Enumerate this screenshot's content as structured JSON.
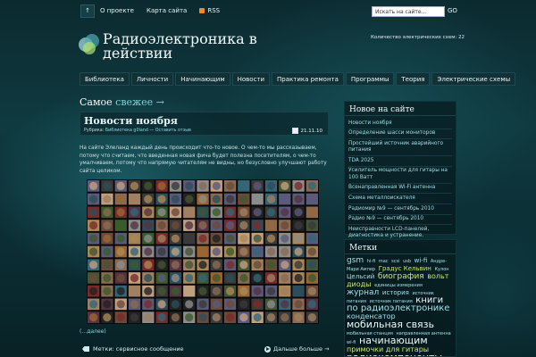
{
  "topbar": {
    "home_label": "↑",
    "nav": [
      "О проекте",
      "Карта сайта",
      "RSS"
    ],
    "search_placeholder": "Искать на сайте...",
    "search_go": "GO"
  },
  "header": {
    "site_title": "Радиоэлектроника в действии",
    "scheme_count": "Количество электрических схем: 22"
  },
  "mainnav": [
    "Библиотека",
    "Личности",
    "Начинающим",
    "Новости",
    "Практика ремонта",
    "Программы",
    "Теория",
    "Электрические схемы"
  ],
  "content": {
    "section_title": "Самое",
    "section_fresh": "свежее →",
    "post": {
      "title": "Новости ноября",
      "meta_prefix": "Рубрика:",
      "meta_category": "Библиотека g0land",
      "meta_sep": "— Оставить отзыв",
      "date": "21.11.10",
      "text": "На сайте Элеланд каждый день происходит что-то новое. О чем-то мы рассказываем, потому что считаем, что введенная новая фича будет полезна посетителям, о чем-то умалчиваем, потому что напрямую читателям не видны, но безусловно улучшают работу сайта целиком.",
      "more_link": "(…далее)",
      "tags_label": "Метки: сервисное сообщение",
      "further": "Дальше больше →"
    }
  },
  "sidebar": {
    "new_title": "Новое на сайте",
    "new_items": [
      "Новости ноября",
      "Определение шасси мониторов",
      "Простейший источник аварийного питания",
      "TDA 2025",
      "Усилитель мощности для гитары на 100 Ватт",
      "Всенаправленная Wi-Fi антенна",
      "Схема металлоискателя",
      "Радиомир №9 — сентябрь 2010",
      "Радио №9 — сентябрь 2010",
      "Неисправности LCD-панелей, диагностика и устранение."
    ],
    "tags_title": "Метки",
    "tag_cloud": [
      {
        "t": "gsm",
        "s": 9,
        "c": "l"
      },
      {
        "t": "hi-fi",
        "s": 5,
        "c": "l"
      },
      {
        "t": "mac",
        "s": 5,
        "c": "l"
      },
      {
        "t": "scsi",
        "s": 5,
        "c": "l"
      },
      {
        "t": "usb",
        "s": 5,
        "c": "l"
      },
      {
        "t": "wi-fi",
        "s": 7,
        "c": "l"
      },
      {
        "t": "Андре-Мари Ампер",
        "s": 5,
        "c": "l"
      },
      {
        "t": "Градус Кельвин",
        "s": 7,
        "c": "g"
      },
      {
        "t": "Кулон",
        "s": 5,
        "c": "l"
      },
      {
        "t": "Цельсий",
        "s": 7,
        "c": "l"
      },
      {
        "t": "биография",
        "s": 9,
        "c": "g"
      },
      {
        "t": "вольт",
        "s": 8,
        "c": "g"
      },
      {
        "t": "диоды",
        "s": 8,
        "c": "g"
      },
      {
        "t": "единицы измерения",
        "s": 5,
        "c": "l"
      },
      {
        "t": "журнал",
        "s": 9,
        "c": "l"
      },
      {
        "t": "история",
        "s": 7,
        "c": "l"
      },
      {
        "t": "источник питания",
        "s": 5,
        "c": "l"
      },
      {
        "t": "источник питания",
        "s": 5,
        "c": "l"
      },
      {
        "t": "книги",
        "s": 10,
        "c": "w"
      },
      {
        "t": "по радиоэлектронике",
        "s": 10,
        "c": "l"
      },
      {
        "t": "конденсатор",
        "s": 8,
        "c": "l"
      },
      {
        "t": "мобильная связь",
        "s": 11,
        "c": "w"
      },
      {
        "t": "мобильная станция",
        "s": 5,
        "c": "l"
      },
      {
        "t": "направленная антенна",
        "s": 5,
        "c": "l"
      },
      {
        "t": "wi-fi",
        "s": 5,
        "c": "l"
      },
      {
        "t": "начинающим",
        "s": 11,
        "c": "w"
      },
      {
        "t": "примочки для гитары",
        "s": 8,
        "c": "g"
      },
      {
        "t": "радиокомпоненты",
        "s": 11,
        "c": "w"
      }
    ]
  },
  "colors": {
    "bg": "#0f3a40",
    "link": "#8fd6e0",
    "tag_green": "#c9e86e"
  }
}
